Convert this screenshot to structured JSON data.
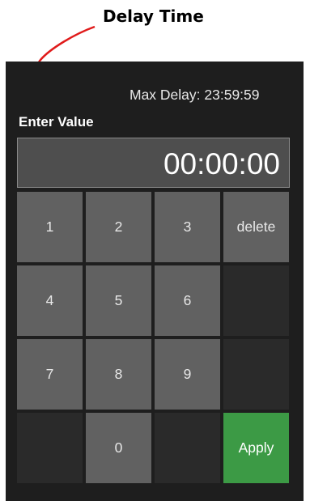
{
  "annotation": {
    "label": "Delay Time",
    "arrow_color": "#e01b1b"
  },
  "header": {
    "max_delay": "Max Delay: 23:59:59",
    "enter_value_label": "Enter Value"
  },
  "display": {
    "value": "00:00:00"
  },
  "keypad": {
    "k1": "1",
    "k2": "2",
    "k3": "3",
    "delete": "delete",
    "k4": "4",
    "k5": "5",
    "k6": "6",
    "k7": "7",
    "k8": "8",
    "k9": "9",
    "k0": "0",
    "apply": "Apply"
  },
  "colors": {
    "panel": "#1e1e1e",
    "key": "#616161",
    "blank_key": "#2a2a2a",
    "apply": "#3c9a45",
    "display": "#4e4e4e"
  }
}
